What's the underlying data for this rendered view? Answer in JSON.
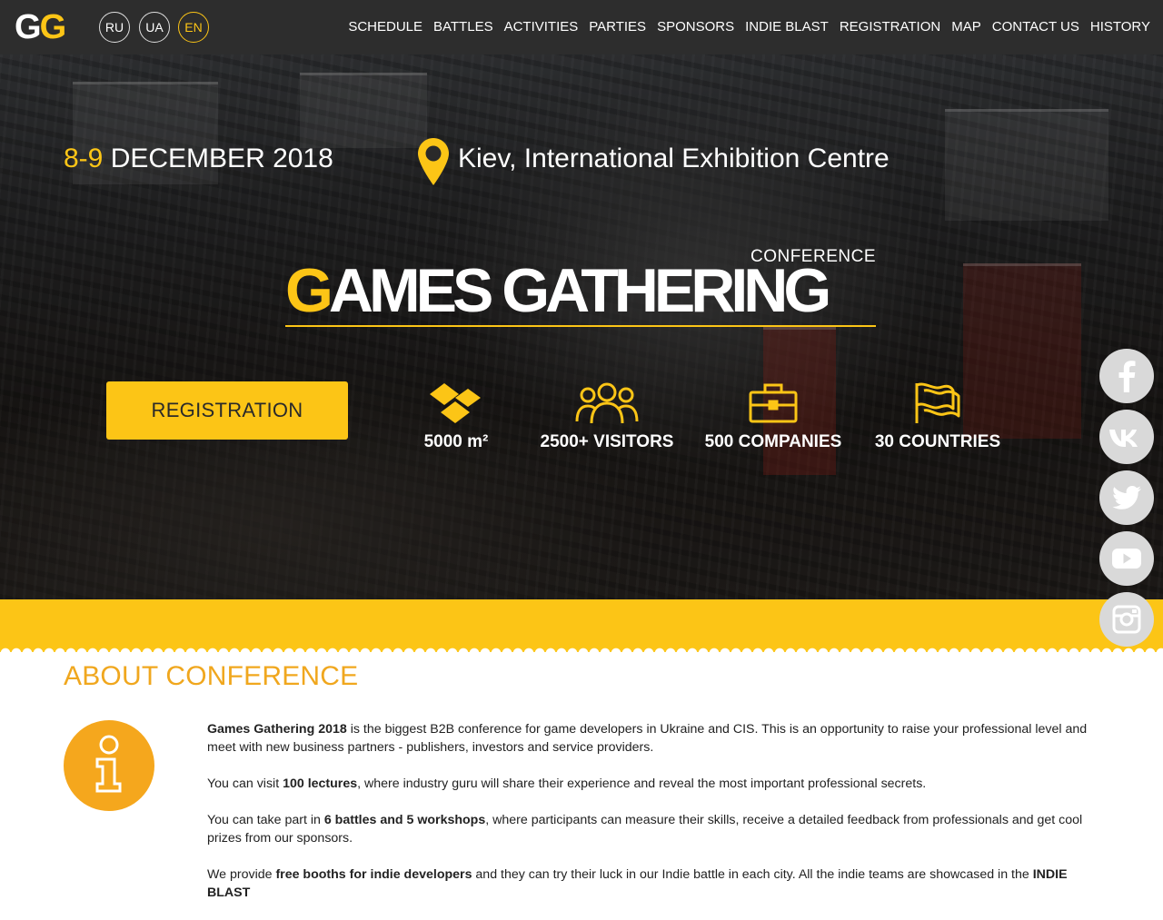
{
  "brand": {
    "logo_first": "G",
    "logo_second": "G"
  },
  "languages": [
    {
      "code": "RU",
      "active": false
    },
    {
      "code": "UA",
      "active": false
    },
    {
      "code": "EN",
      "active": true
    }
  ],
  "nav": [
    "SCHEDULE",
    "BATTLES",
    "ACTIVITIES",
    "PARTIES",
    "SPONSORS",
    "INDIE BLAST",
    "REGISTRATION",
    "MAP",
    "CONTACT US",
    "HISTORY"
  ],
  "hero": {
    "date_highlight": "8-9",
    "date_rest": "DECEMBER 2018",
    "location": "Kiev, International Exhibition Centre",
    "title_label": "CONFERENCE",
    "title_first_letter": "G",
    "title_rest": "AMES GATHERING",
    "registration_button": "REGISTRATION",
    "stats": [
      {
        "icon": "area-icon",
        "label": "5000 m²"
      },
      {
        "icon": "visitors-icon",
        "label": "2500+ VISITORS"
      },
      {
        "icon": "briefcase-icon",
        "label": "500 COMPANIES"
      },
      {
        "icon": "flag-icon",
        "label": "30 COUNTRIES"
      }
    ]
  },
  "social": [
    "facebook-icon",
    "vk-icon",
    "twitter-icon",
    "youtube-icon",
    "instagram-icon"
  ],
  "colors": {
    "accent": "#fcc516",
    "heading": "#f0a71e",
    "info_circle": "#f5a71d",
    "topbar": "#2d2d2d"
  },
  "about": {
    "heading": "ABOUT CONFERENCE",
    "p1_bold": "Games Gathering 2018",
    "p1_rest": " is the biggest B2B conference for game developers in Ukraine and CIS. This is an opportunity to raise your professional level and meet with new business partners - publishers, investors and service providers.",
    "p2_pre": "You can visit ",
    "p2_bold": "100 lectures",
    "p2_post": ", where industry guru will share their experience and reveal the most important professional secrets.",
    "p3_pre": "You can take part in ",
    "p3_bold": "6 battles and 5 workshops",
    "p3_post": ", where participants can measure their skills, receive a detailed feedback from professionals and get cool prizes from our sponsors.",
    "p4_pre": "We provide ",
    "p4_bold": "free booths for indie developers",
    "p4_mid": " and they can try their luck in our Indie battle in each city. All the indie teams are showcased in the ",
    "p4_bold2": "INDIE BLAST"
  }
}
